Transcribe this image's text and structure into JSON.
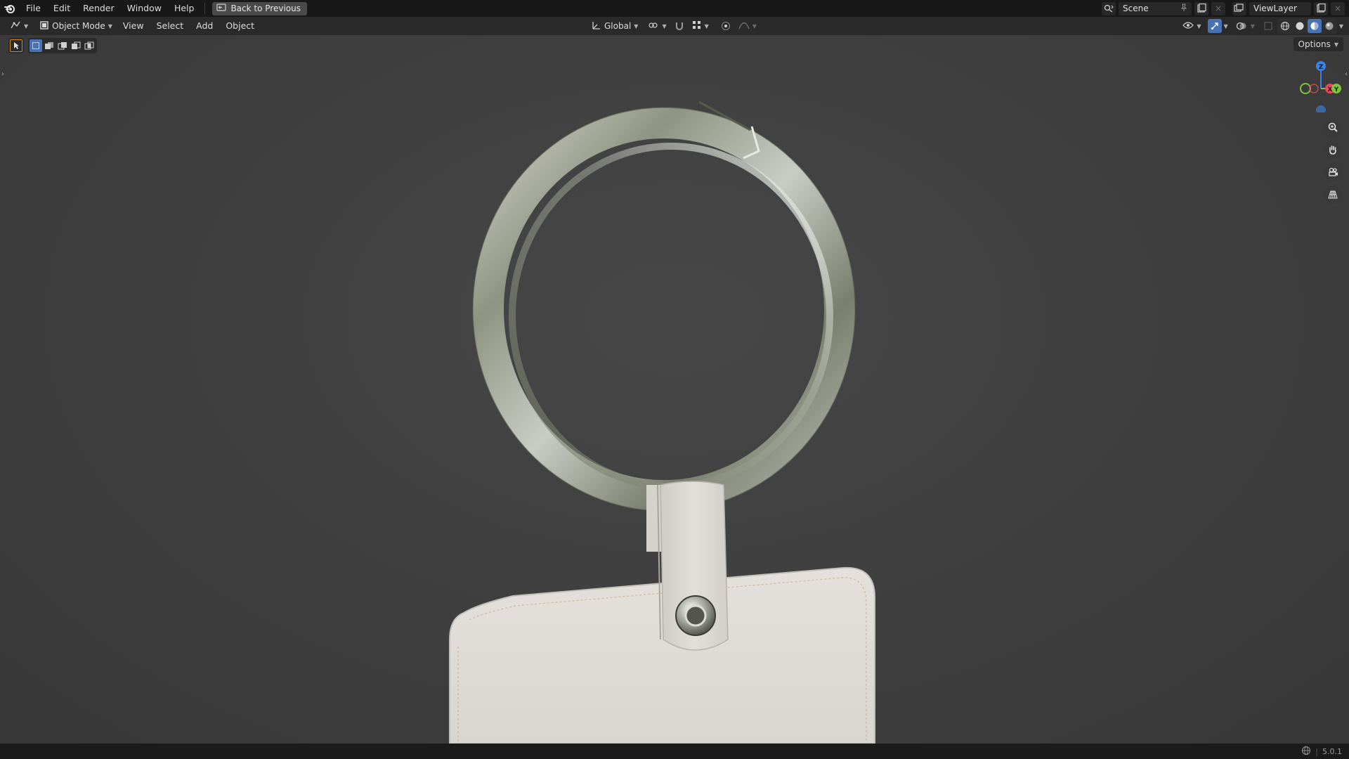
{
  "topbar": {
    "menus": [
      "File",
      "Edit",
      "Render",
      "Window",
      "Help"
    ],
    "back_button": "Back to Previous",
    "scene_name": "Scene",
    "view_layer": "ViewLayer"
  },
  "viewport_header": {
    "mode": "Object Mode",
    "menus": [
      "View",
      "Select",
      "Add",
      "Object"
    ],
    "orientation": "Global",
    "options_label": "Options"
  },
  "gizmo": {
    "axes": [
      "X",
      "Y",
      "Z"
    ],
    "colors": {
      "x": "#e84a5f",
      "y": "#7ec43f",
      "z": "#3b82e0"
    }
  },
  "status": {
    "version": "5.0.1"
  },
  "colors": {
    "accent": "#4772b3",
    "background": "#3d3d3d"
  }
}
